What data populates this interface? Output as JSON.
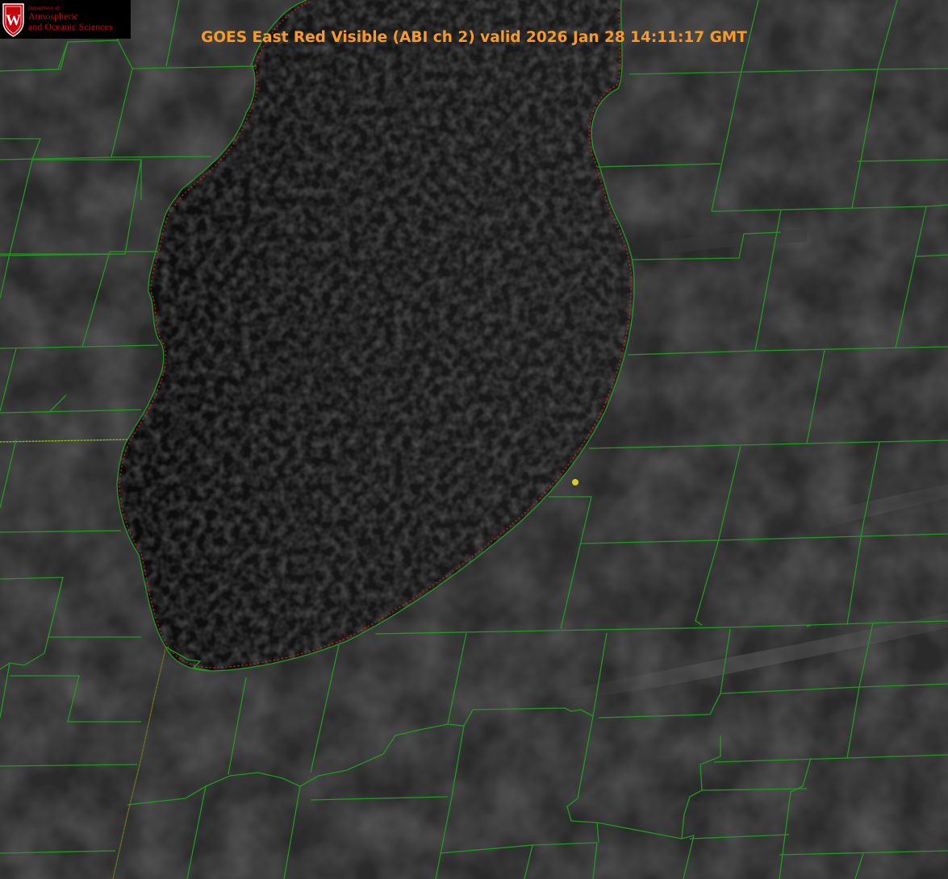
{
  "title": "GOES East Red Visible (ABI ch 2) valid 2026 Jan 28 14:11:17 GMT",
  "logo": {
    "department": "Department of",
    "line1": "Atmospheric",
    "line2": "and Oceanic Sciences",
    "crest_letter": "W"
  },
  "colors": {
    "title": "#f79a2a",
    "county_lines": "#1f9a1f",
    "coastline_dotted": "#d22020",
    "marker": "#d8d020",
    "land": "#2b2b2b",
    "lake": "#141414",
    "logo_red": "#c5050c"
  },
  "layers": [
    "county-boundaries",
    "lake-shoreline",
    "state-boundary",
    "station-marker"
  ]
}
